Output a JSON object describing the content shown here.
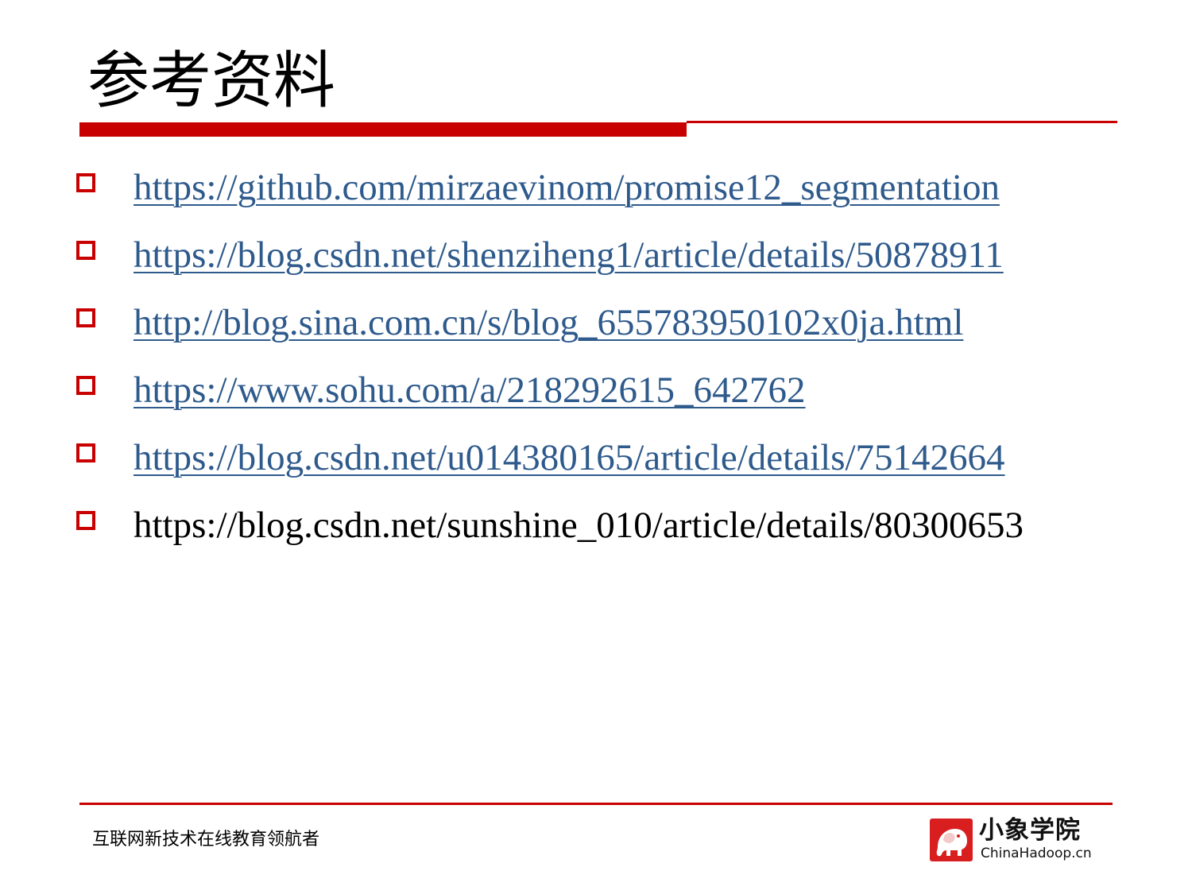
{
  "slide": {
    "title": "参考资料",
    "references": [
      {
        "text": "https://github.com/mirzaevinom/promise12_segmentation",
        "linked": true
      },
      {
        "text": "https://blog.csdn.net/shenziheng1/article/details/50878911",
        "linked": true
      },
      {
        "text": "http://blog.sina.com.cn/s/blog_655783950102x0ja.html",
        "linked": true
      },
      {
        "text": "https://www.sohu.com/a/218292615_642762",
        "linked": true
      },
      {
        "text": "https://blog.csdn.net/u014380165/article/details/75142664",
        "linked": true
      },
      {
        "text": "https://blog.csdn.net/sunshine_010/article/details/80300653",
        "linked": false
      }
    ]
  },
  "footer": {
    "slogan": "互联网新技术在线教育领航者",
    "logo_name": "小象学院",
    "logo_domain": "ChinaHadoop.cn",
    "logo_icon": "elephant-icon"
  },
  "colors": {
    "accent": "#c80000",
    "link": "#2e5a8c",
    "text": "#000000"
  }
}
